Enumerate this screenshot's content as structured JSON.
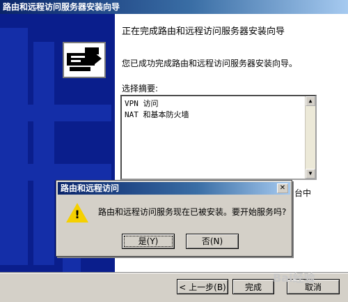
{
  "window": {
    "title": "路由和远程访问服务器安装向导"
  },
  "main": {
    "heading": "正在完成路由和远程访问服务器安装向导",
    "subtext": "您已成功完成路由和远程访问服务器安装向导。",
    "summary_label": "选择摘要:",
    "summary_lines": [
      "VPN 访问",
      "NAT 和基本防火墙"
    ],
    "obscured_text": "台中"
  },
  "buttons": {
    "back": "< 上一步(B)",
    "finish": "完成",
    "cancel": "取消"
  },
  "dialog": {
    "title": "路由和远程访问",
    "message": "路由和远程访问服务现在已被安装。要开始服务吗?",
    "yes": "是(Y)",
    "no": "否(N)"
  },
  "watermark": "Bai经验"
}
